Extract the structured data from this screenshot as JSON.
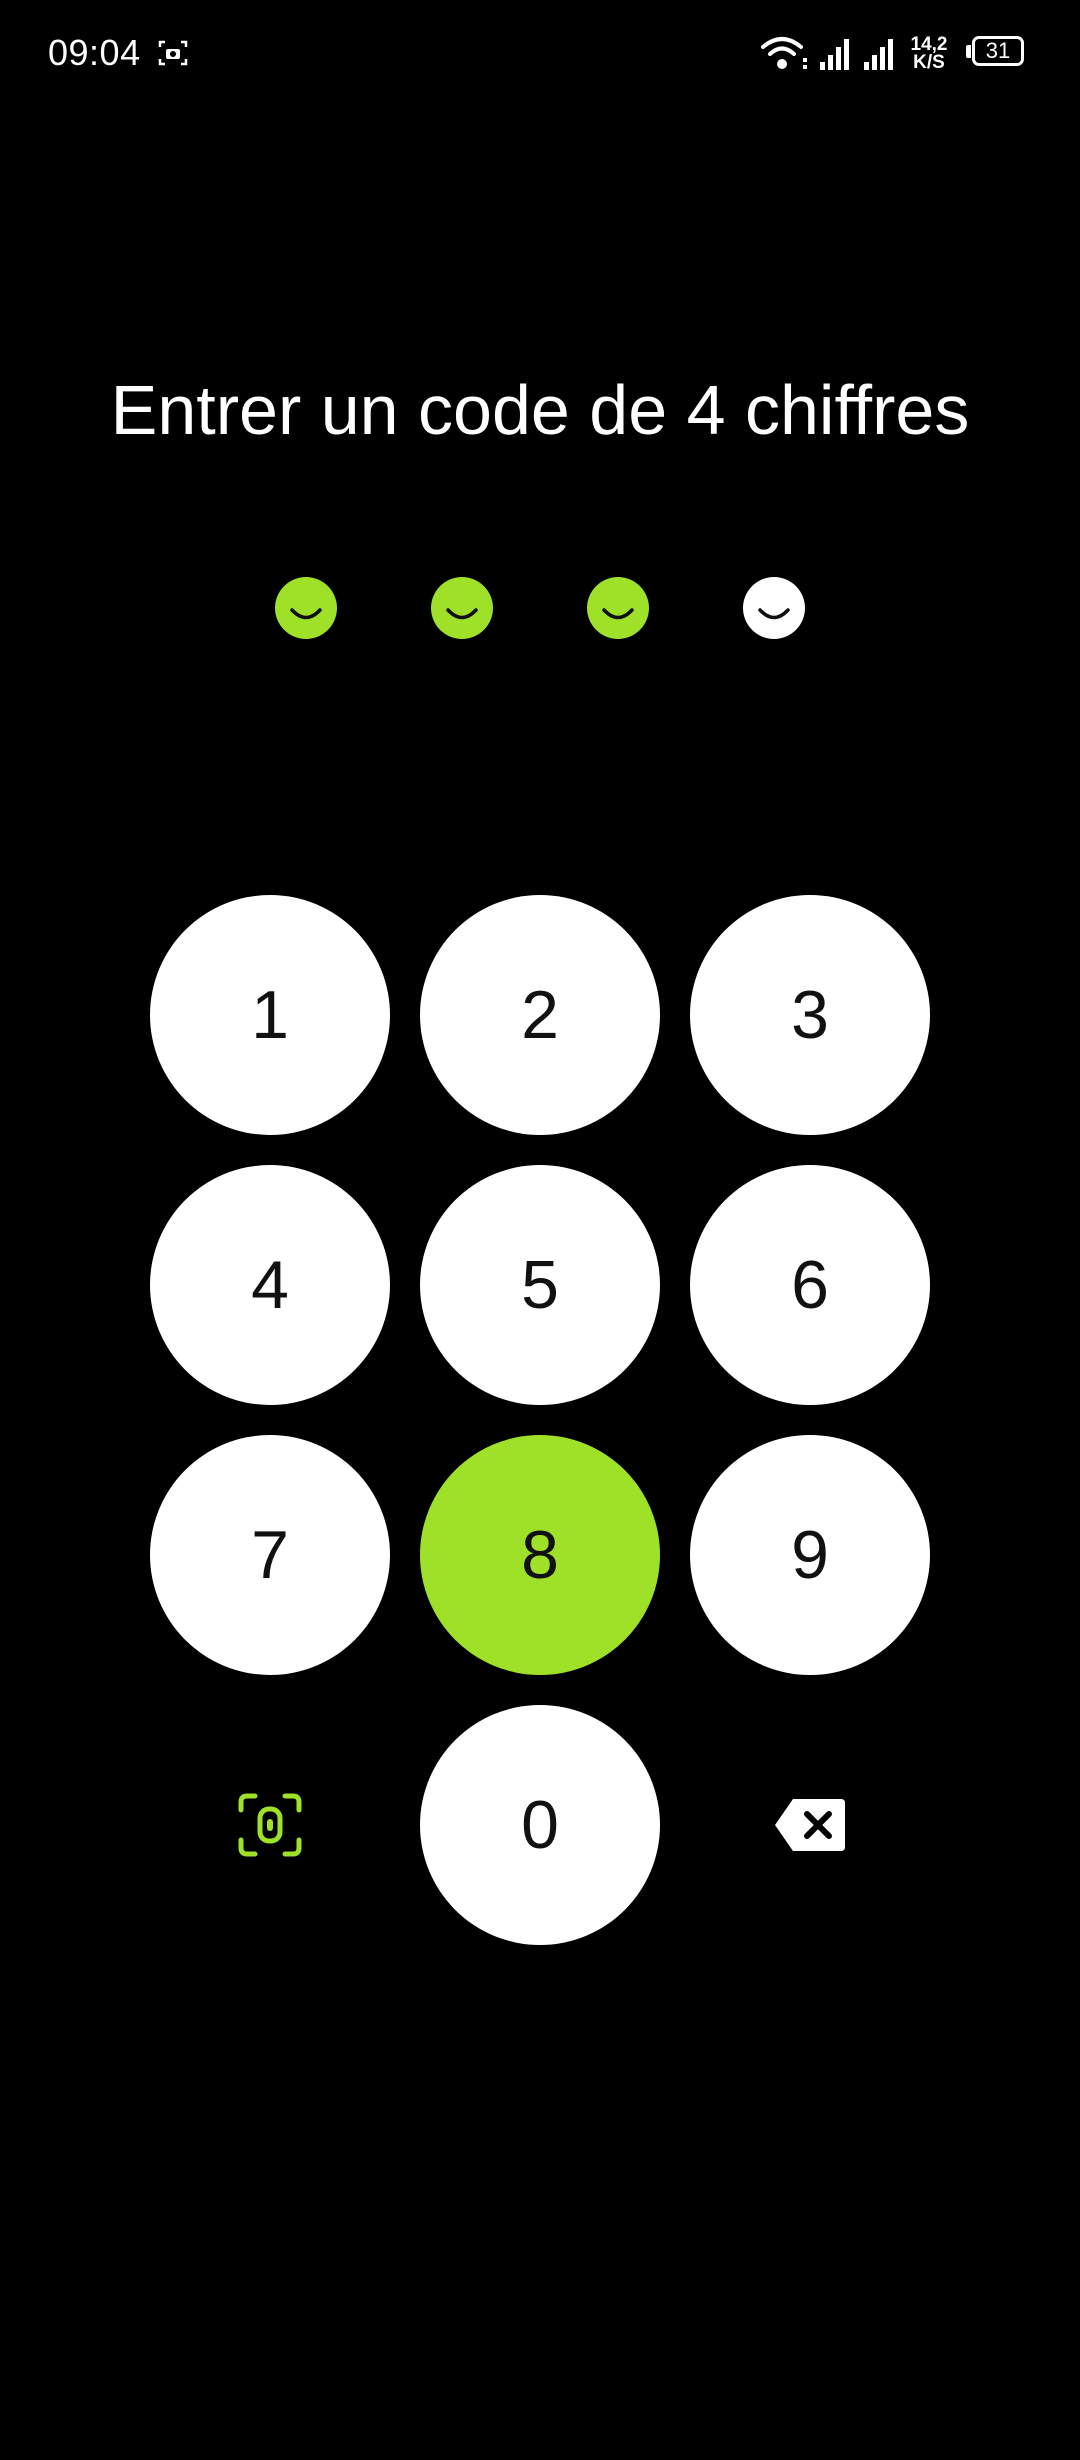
{
  "status_bar": {
    "time": "09:04",
    "net_speed_value": "14,2",
    "net_speed_unit": "K/S",
    "battery_level": "31",
    "icons": [
      "screenshot-icon",
      "wifi-icon",
      "signal-icon",
      "signal-icon",
      "battery-icon"
    ]
  },
  "title": "Entrer un code de 4 chiffres",
  "pin": {
    "length": 4,
    "filled": 3,
    "filled_color": "#9ee128",
    "empty_color": "#ffffff"
  },
  "keypad": {
    "keys": [
      "1",
      "2",
      "3",
      "4",
      "5",
      "6",
      "7",
      "8",
      "9",
      "0"
    ],
    "pressed_key": "8",
    "left_action_icon": "face-id-icon",
    "right_action_icon": "backspace-icon"
  },
  "colors": {
    "background": "#000000",
    "accent": "#9ee128",
    "key_background": "#ffffff",
    "key_text": "#111111"
  }
}
